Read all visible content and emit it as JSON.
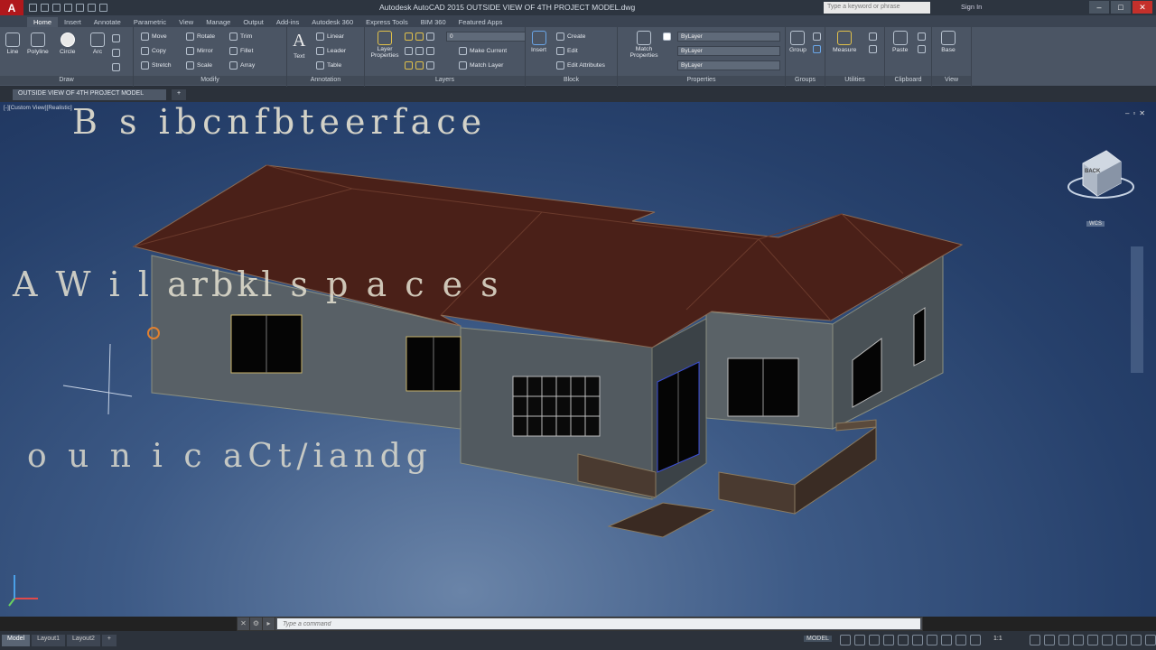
{
  "titlebar": {
    "app_button": "A",
    "title": "Autodesk AutoCAD 2015   OUTSIDE VIEW OF 4TH PROJECT MODEL.dwg",
    "search_placeholder": "Type a keyword or phrase",
    "signin": "Sign In"
  },
  "ribbon_tabs": [
    "Home",
    "Insert",
    "Annotate",
    "Parametric",
    "View",
    "Manage",
    "Output",
    "Add-ins",
    "Autodesk 360",
    "Express Tools",
    "BIM 360",
    "Featured Apps"
  ],
  "ribbon": {
    "draw": {
      "line": "Line",
      "polyline": "Polyline",
      "circle": "Circle",
      "arc": "Arc",
      "label": "Draw"
    },
    "modify": {
      "move": "Move",
      "rotate": "Rotate",
      "trim": "Trim",
      "copy": "Copy",
      "mirror": "Mirror",
      "fillet": "Fillet",
      "stretch": "Stretch",
      "scale": "Scale",
      "array": "Array",
      "label": "Modify"
    },
    "annotation": {
      "text": "Text",
      "linear": "Linear",
      "leader": "Leader",
      "table": "Table",
      "label": "Annotation"
    },
    "layers": {
      "layer_properties": "Layer Properties",
      "current_layer": "0",
      "make_current": "Make Current",
      "match_layer": "Match Layer",
      "label": "Layers"
    },
    "block": {
      "insert": "Insert",
      "create": "Create",
      "edit": "Edit",
      "edit_attributes": "Edit Attributes",
      "label": "Block"
    },
    "properties": {
      "match": "Match Properties",
      "color": "ByLayer",
      "linetype": "ByLayer",
      "lineweight": "ByLayer",
      "label": "Properties"
    },
    "groups": {
      "group": "Group",
      "label": "Groups"
    },
    "utilities": {
      "measure": "Measure",
      "label": "Utilities"
    },
    "clipboard": {
      "paste": "Paste",
      "label": "Clipboard"
    },
    "view": {
      "base": "Base",
      "label": "View"
    }
  },
  "file_tabs": [
    "OUTSIDE VIEW OF 4TH PROJECT MODEL"
  ],
  "viewport": {
    "label": "[-][Custom View][Realistic]",
    "viewcube_label": "BACK",
    "wcs_label": "WCS"
  },
  "overlay_text": {
    "line1": "B  s  ibcnfbteerface",
    "line2": "A  W  i  l  arbkl  s  p  a  c  e  s",
    "line3": "o  u  n  i  c  aCt/iandg"
  },
  "command_line": {
    "placeholder": "Type a command"
  },
  "status_bar": {
    "model_tab": "Model",
    "layout1": "Layout1",
    "layout2": "Layout2",
    "space": "MODEL",
    "scale": "1:1"
  },
  "colors": {
    "accent": "#b0181c",
    "viewport_bg": "#26406b",
    "roof": "#4a2018",
    "walls": "#5a6366"
  }
}
